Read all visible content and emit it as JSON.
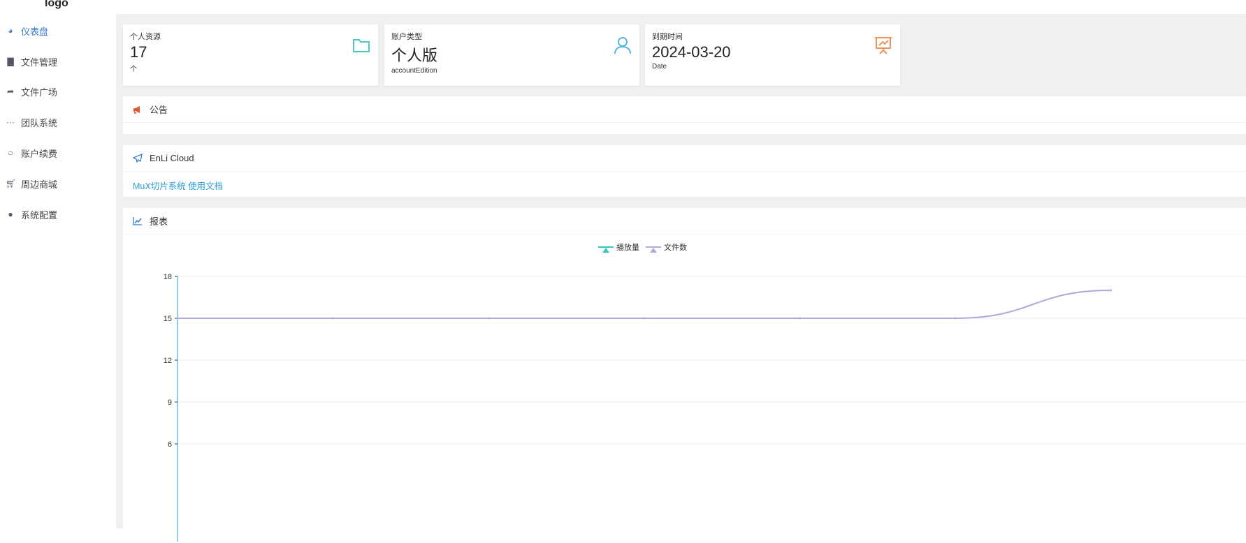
{
  "logo": "logo",
  "sidebar": {
    "items": [
      {
        "label": "仪表盘",
        "icon": "dashboard-icon"
      },
      {
        "label": "文件管理",
        "icon": "file-icon"
      },
      {
        "label": "文件广场",
        "icon": "share-icon"
      },
      {
        "label": "团队系统",
        "icon": "ellipsis-icon"
      },
      {
        "label": "账户续费",
        "icon": "circle-icon"
      },
      {
        "label": "周边商城",
        "icon": "cart-icon"
      },
      {
        "label": "系统配置",
        "icon": "user-icon"
      }
    ]
  },
  "cards": [
    {
      "label": "个人资源",
      "value": "17",
      "sub": "个",
      "icon": "folder-icon",
      "color": "#4dc7c4"
    },
    {
      "label": "账户类型",
      "value": "个人版",
      "sub": "accountEdition",
      "icon": "user-icon",
      "color": "#53b8de"
    },
    {
      "label": "到期时间",
      "value": "2024-03-20",
      "sub": "Date",
      "icon": "presentation-chart-icon",
      "color": "#f0905a"
    }
  ],
  "notice": {
    "title": "公告"
  },
  "cloud": {
    "title": "EnLi Cloud",
    "link": "MuX切片系统 使用文档"
  },
  "report": {
    "title": "报表"
  },
  "chart_data": {
    "type": "line",
    "legend": [
      "播放量",
      "文件数"
    ],
    "legend_placement": "top-center",
    "y_ticks": [
      6,
      9,
      12,
      15,
      18
    ],
    "ylim": [
      3,
      18
    ],
    "series": [
      {
        "name": "播放量",
        "color": "#3cc4c0",
        "values": []
      },
      {
        "name": "文件数",
        "color": "#b3a6d9",
        "values": [
          15,
          15,
          15,
          15,
          15,
          15,
          17
        ]
      }
    ]
  }
}
